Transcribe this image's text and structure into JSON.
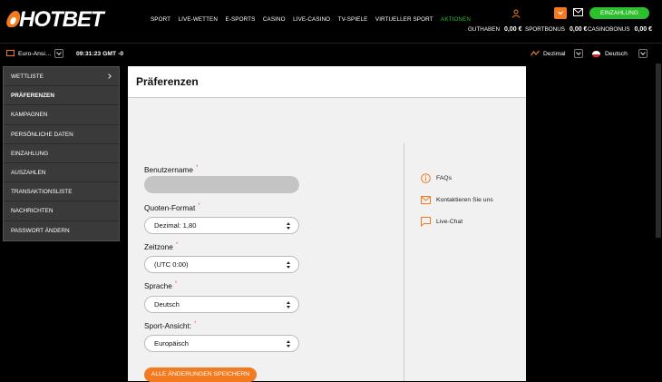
{
  "brand": {
    "logo": "HOTBET"
  },
  "nav": {
    "items": [
      {
        "label": "SPORT"
      },
      {
        "label": "LIVE-WETTEN"
      },
      {
        "label": "E-SPORTS"
      },
      {
        "label": "CASINO"
      },
      {
        "label": "LIVE-CASINO"
      },
      {
        "label": "TV-SPIELE"
      },
      {
        "label": "VIRTUELLER SPORT"
      },
      {
        "label": "AKTIONEN"
      }
    ]
  },
  "header": {
    "deposit_label": "EINZAHLUNG",
    "balances": {
      "guthaben_label": "GUTHABEN",
      "guthaben_value": "0,00 €",
      "sportbonus_label": "SPORTBONUS",
      "sportbonus_value": "0,00 €",
      "casinobonus_label": "CASINOBONUS",
      "casinobonus_value": "0,00 €"
    },
    "accent": "#f47a20",
    "green": "#2dbf2d"
  },
  "subbar": {
    "view": "Euro-Ansi…",
    "clock": "09:31:23 GMT -0",
    "odds_format": "Dezimal",
    "language": "Deutsch"
  },
  "menu": {
    "items": [
      {
        "label": "WETTLISTE"
      },
      {
        "label": "PRÄFERENZEN"
      },
      {
        "label": "KAMPAGNEN"
      },
      {
        "label": "PERSÖNLICHE DATEN"
      },
      {
        "label": "EINZAHLUNG"
      },
      {
        "label": "AUSZAHLEN"
      },
      {
        "label": "TRANSAKTIONSLISTE"
      },
      {
        "label": "NACHRICHTEN"
      },
      {
        "label": "PASSWORT ÄNDERN"
      }
    ]
  },
  "page": {
    "title": "Präferenzen"
  },
  "form": {
    "username_label": "Benutzername",
    "odds_label": "Quoten-Format",
    "odds_value": "Dezimal: 1,80",
    "timezone_label": "Zeitzone",
    "timezone_value": "(UTC 0:00)",
    "language_label": "Sprache",
    "language_value": "Deutsch",
    "view_label": "Sport-Ansicht:",
    "view_value": "Europäisch",
    "save_label": "ALLE ÄNDERUNGEN SPEICHERN",
    "required_mark": "*"
  },
  "help": {
    "faqs": "FAQs",
    "contact": "Kontaktieren Sie uns",
    "chat": "Live-Chat"
  }
}
